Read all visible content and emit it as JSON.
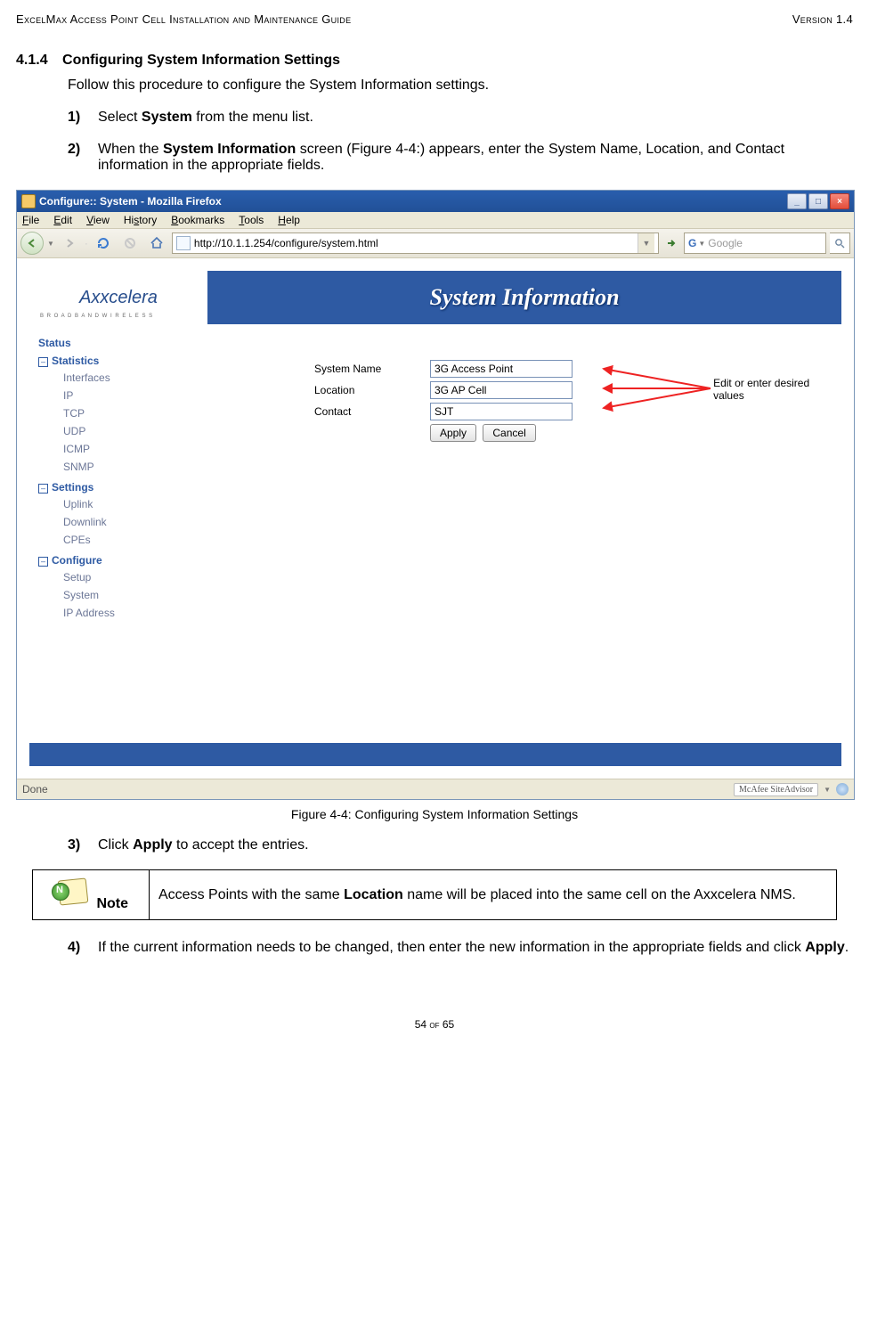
{
  "header_left": "ExcelMax Access Point Cell Installation and Maintenance Guide",
  "header_right": "Version 1.4",
  "section": {
    "number": "4.1.4",
    "title": "Configuring System Information Settings"
  },
  "intro": "Follow this procedure to configure the System Information settings.",
  "steps12": [
    {
      "n": "1)",
      "html": "Select <b>System</b> from the menu list."
    },
    {
      "n": "2)",
      "html": "When the <b>System Information</b> screen (Figure 4-4:) appears, enter the System Name, Location, and Contact information in the appropriate fields."
    }
  ],
  "browser": {
    "title": "Configure:: System - Mozilla Firefox",
    "menus": [
      "File",
      "Edit",
      "View",
      "History",
      "Bookmarks",
      "Tools",
      "Help"
    ],
    "url": "http://10.1.1.254/configure/system.html",
    "search_placeholder": "Google"
  },
  "page_title_bar": "System Information",
  "logo_text": "Axxcelera",
  "logo_sub": "B R O A D B A N D   W I R E L E S S",
  "sidebar": {
    "status": "Status",
    "groups": [
      {
        "label": "Statistics",
        "items": [
          "Interfaces",
          "IP",
          "TCP",
          "UDP",
          "ICMP",
          "SNMP"
        ]
      },
      {
        "label": "Settings",
        "items": [
          "Uplink",
          "Downlink",
          "CPEs"
        ]
      },
      {
        "label": "Configure",
        "items": [
          "Setup",
          "System",
          "IP Address"
        ]
      }
    ]
  },
  "form": {
    "rows": [
      {
        "label": "System Name",
        "value": "3G Access Point"
      },
      {
        "label": "Location",
        "value": "3G AP Cell"
      },
      {
        "label": "Contact",
        "value": "SJT"
      }
    ],
    "apply": "Apply",
    "cancel": "Cancel"
  },
  "annotation": "Edit or enter desired values",
  "status_done": "Done",
  "mcafee": "McAfee SiteAdvisor",
  "figure_caption": "Figure 4-4: Configuring System Information Settings",
  "step3": {
    "n": "3)",
    "html": "Click <b>Apply</b> to accept the entries."
  },
  "note_label": "Note",
  "note_html": "Access Points with the same <b>Location</b> name will be placed into the same cell on the Axxcelera NMS.",
  "step4": {
    "n": "4)",
    "html": "If the current information needs to be changed, then enter the new information in the appropriate fields and click <b>Apply</b>."
  },
  "page_foot": "54 of 65"
}
